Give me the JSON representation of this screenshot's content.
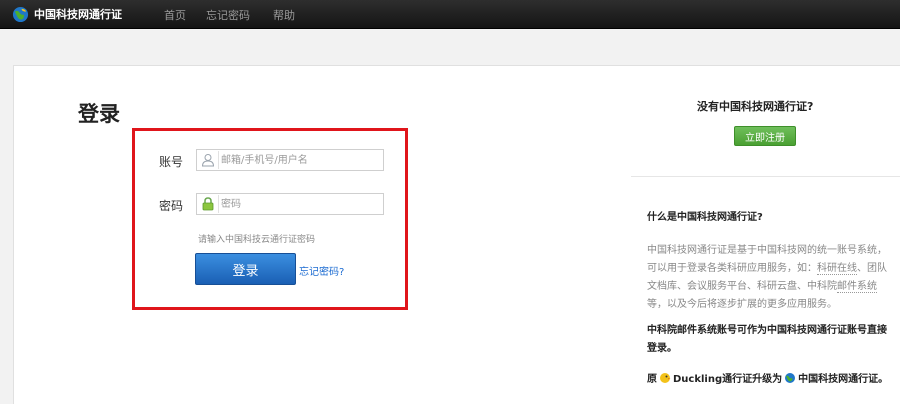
{
  "navbar": {
    "logo_text": "中国科技网通行证",
    "items": [
      "首页",
      "忘记密码",
      "帮助"
    ]
  },
  "login": {
    "title": "登录",
    "account_label": "账号",
    "account_placeholder": "邮箱/手机号/用户名",
    "password_label": "密码",
    "password_placeholder": "密码",
    "hint": "请输入中国科技云通行证密码",
    "submit_label": "登录",
    "forgot_label": "忘记密码?"
  },
  "sidebar": {
    "question": "没有中国科技网通行证?",
    "register_label": "立即注册",
    "what_title": "什么是中国科技网通行证?",
    "desc_part1": "中国科技网通行证是基于中国科技网的统一账号系统，可以用于登录各类科研应用服务，如：",
    "desc_link1": "科研在线",
    "desc_part2": "、团队文档库、会议服务平台、科研云盘、中科院",
    "desc_link2": "邮件系统",
    "desc_part3": "等，以及今后将逐步扩展的更多应用服务。",
    "mail_note": "中科院邮件系统账号可作为中国科技网通行证账号直接登录。",
    "upgrade_prefix": "原",
    "upgrade_middle": "Duckling通行证升级为",
    "upgrade_suffix": "中国科技网通行证。"
  },
  "colors": {
    "highlight_frame": "#e0151b",
    "login_button": "#1a5fb4",
    "register_button": "#4aa032",
    "link": "#1a6ad1"
  },
  "icons": {
    "logo": "globe-icon",
    "account": "user-icon",
    "password": "lock-icon"
  }
}
